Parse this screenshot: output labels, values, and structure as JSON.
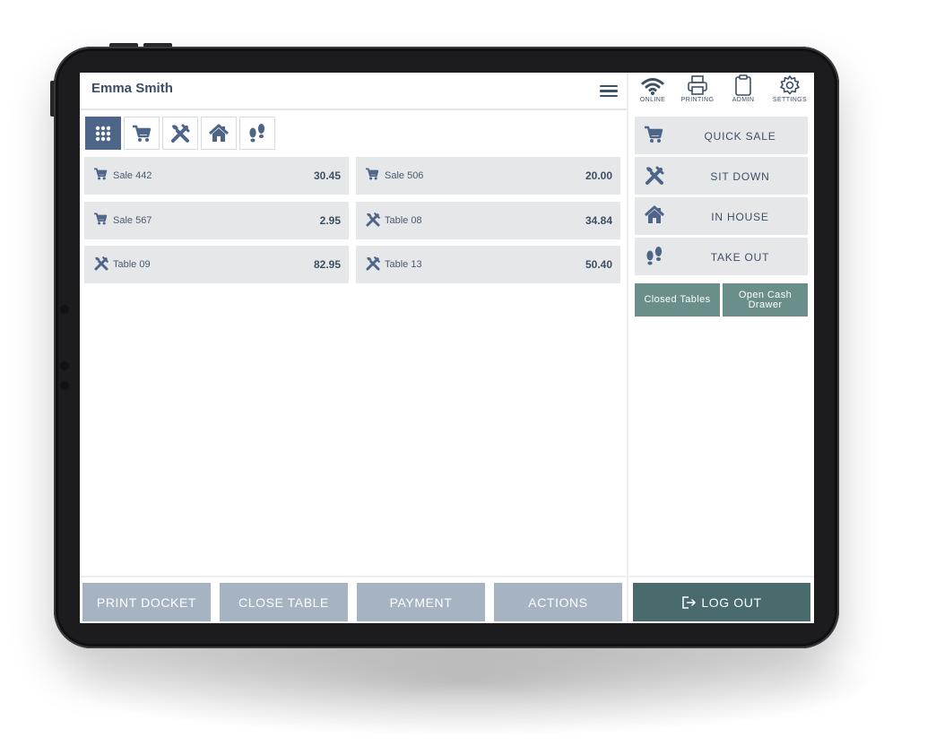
{
  "header": {
    "user_name": "Emma Smith"
  },
  "status_bar": [
    {
      "label": "ONLINE",
      "icon": "wifi-icon"
    },
    {
      "label": "PRINTING",
      "icon": "printer-icon"
    },
    {
      "label": "ADMIN",
      "icon": "clipboard-icon"
    },
    {
      "label": "SETTINGS",
      "icon": "gear-icon"
    }
  ],
  "filters": [
    {
      "icon": "grid-icon",
      "active": true
    },
    {
      "icon": "cart-icon",
      "active": false
    },
    {
      "icon": "cutlery-icon",
      "active": false
    },
    {
      "icon": "house-icon",
      "active": false
    },
    {
      "icon": "footprints-icon",
      "active": false
    }
  ],
  "orders": [
    {
      "icon": "cart-icon",
      "label": "Sale 442",
      "amount": "30.45"
    },
    {
      "icon": "cart-icon",
      "label": "Sale 506",
      "amount": "20.00"
    },
    {
      "icon": "cart-icon",
      "label": "Sale 567",
      "amount": "2.95"
    },
    {
      "icon": "cutlery-icon",
      "label": "Table 08",
      "amount": "34.84"
    },
    {
      "icon": "cutlery-icon",
      "label": "Table 09",
      "amount": "82.95"
    },
    {
      "icon": "cutlery-icon",
      "label": "Table 13",
      "amount": "50.40"
    }
  ],
  "side_menu": [
    {
      "icon": "cart-icon",
      "label": "QUICK SALE"
    },
    {
      "icon": "cutlery-icon",
      "label": "SIT DOWN"
    },
    {
      "icon": "house-icon",
      "label": "IN HOUSE"
    },
    {
      "icon": "footprints-icon",
      "label": "TAKE OUT"
    }
  ],
  "side_actions": {
    "closed_tables": "Closed Tables",
    "open_cash_drawer": "Open Cash Drawer"
  },
  "bottom_actions": [
    "PRINT DOCKET",
    "CLOSE TABLE",
    "PAYMENT",
    "ACTIONS"
  ],
  "logout": {
    "label": "LOG OUT",
    "icon": "logout-icon"
  },
  "colors": {
    "primary": "#4d6588",
    "text": "#3d4f66",
    "tile": "#e6e7e8",
    "action_button": "#a5b3c3",
    "teal": "#6a8e8a",
    "logout": "#4a6b6e"
  }
}
